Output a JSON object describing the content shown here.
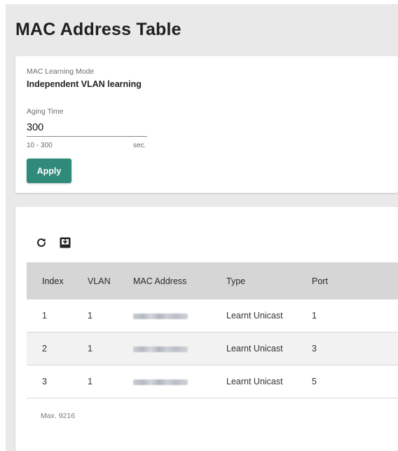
{
  "page": {
    "title": "MAC Address Table"
  },
  "settings": {
    "learning_mode_label": "MAC Learning Mode",
    "learning_mode_value": "Independent VLAN learning",
    "aging_time_label": "Aging Time",
    "aging_time_value": "300",
    "aging_time_range": "10 - 300",
    "aging_time_unit": "sec.",
    "apply_label": "Apply"
  },
  "toolbar": {
    "icons": [
      "refresh-icon",
      "export-icon"
    ]
  },
  "table": {
    "headers": {
      "index": "Index",
      "vlan": "VLAN",
      "mac": "MAC Address",
      "type": "Type",
      "port": "Port"
    },
    "rows": [
      {
        "index": "1",
        "vlan": "1",
        "type": "Learnt Unicast",
        "port": "1"
      },
      {
        "index": "2",
        "vlan": "1",
        "type": "Learnt Unicast",
        "port": "3"
      },
      {
        "index": "3",
        "vlan": "1",
        "type": "Learnt Unicast",
        "port": "5"
      }
    ],
    "footer": "Max. 9216"
  },
  "colors": {
    "accent": "#2f8a79",
    "page_background": "#e9e9e9",
    "header_background": "#d6d6d6"
  }
}
